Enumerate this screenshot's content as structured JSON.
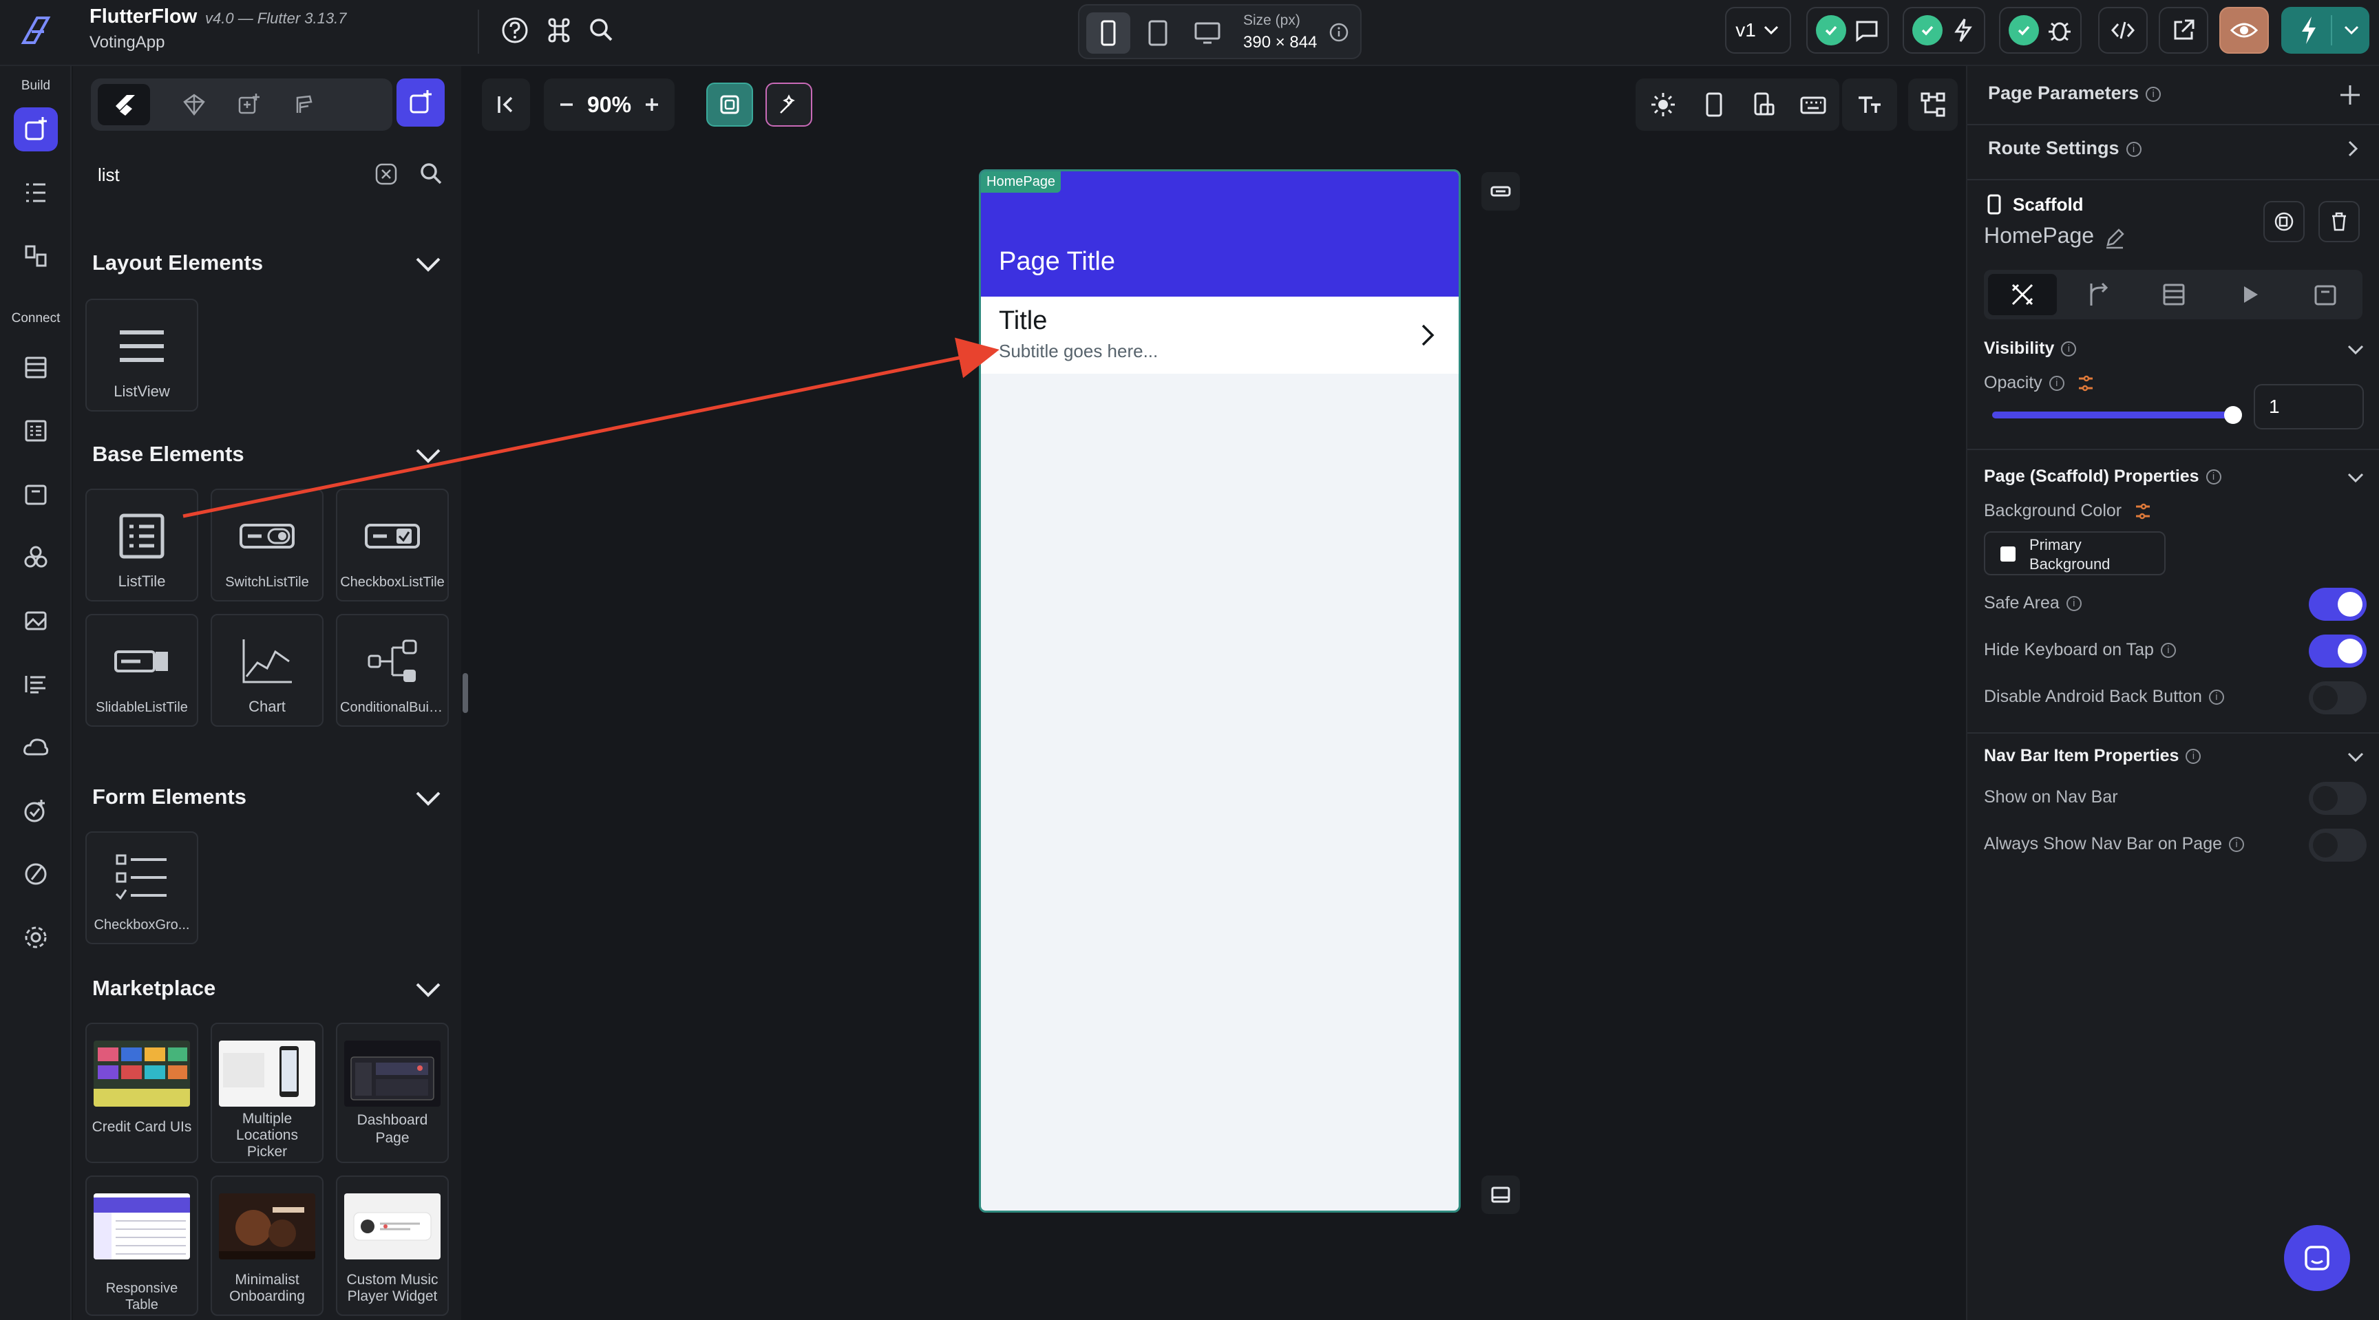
{
  "app": {
    "name": "FlutterFlow",
    "version": "v4.0 — Flutter 3.13.7",
    "project": "VotingApp"
  },
  "topbar": {
    "size_label": "Size (px)",
    "size_value": "390 × 844",
    "version_selector": "v1"
  },
  "leftnav": {
    "section_build": "Build",
    "section_connect": "Connect"
  },
  "widget_panel": {
    "search_value": "list",
    "sections": {
      "layout": "Layout Elements",
      "base": "Base Elements",
      "form": "Form Elements",
      "marketplace": "Marketplace"
    },
    "layout_items": [
      "ListView"
    ],
    "base_items": [
      "ListTile",
      "SwitchListTile",
      "CheckboxListTile",
      "SlidableListTile",
      "Chart",
      "ConditionalBuild..."
    ],
    "form_items": [
      "CheckboxGro..."
    ],
    "marketplace_items": [
      "Credit Card UIs",
      "Multiple",
      "Locations Picker",
      "Dashboard",
      "Page",
      "Responsive Table",
      "Minimalist",
      "Onboarding",
      "Custom Music",
      "Player Widget"
    ]
  },
  "canvas": {
    "zoom": "90%",
    "page_tag": "HomePage",
    "page_title": "Page Title",
    "list_tile_title": "Title",
    "list_tile_subtitle": "Subtitle goes here..."
  },
  "properties": {
    "page_parameters": "Page Parameters",
    "route_settings": "Route Settings",
    "widget_type": "Scaffold",
    "widget_name": "HomePage",
    "visibility": "Visibility",
    "opacity_label": "Opacity",
    "opacity_value": "1",
    "opacity_level": 1.0,
    "scaffold_props": "Page (Scaffold) Properties",
    "background_color_label": "Background Color",
    "background_color_value_1": "Primary",
    "background_color_value_2": "Background",
    "safe_area": "Safe Area",
    "hide_keyboard": "Hide Keyboard on Tap",
    "disable_back": "Disable Android Back Button",
    "nav_bar_props": "Nav Bar Item Properties",
    "show_nav_bar": "Show on Nav Bar",
    "always_show_nav": "Always Show Nav Bar on Page",
    "toggles": {
      "safe_area": true,
      "hide_keyboard": true,
      "disable_back": false,
      "show_nav_bar": false,
      "always_show_nav": false
    }
  },
  "colors": {
    "accent": "#4b45e6",
    "appbar": "#3c31e0",
    "success": "#3bc28f",
    "arrow": "#e8432e"
  },
  "icons": [
    "logo-icon",
    "help-icon",
    "command-icon",
    "search-icon",
    "phone-icon",
    "tablet-icon",
    "desktop-icon",
    "info-icon",
    "chat-icon",
    "bolt-icon",
    "bug-icon",
    "code-icon",
    "external-link-icon",
    "eye-icon",
    "flash-icon",
    "chevron-down-icon"
  ]
}
